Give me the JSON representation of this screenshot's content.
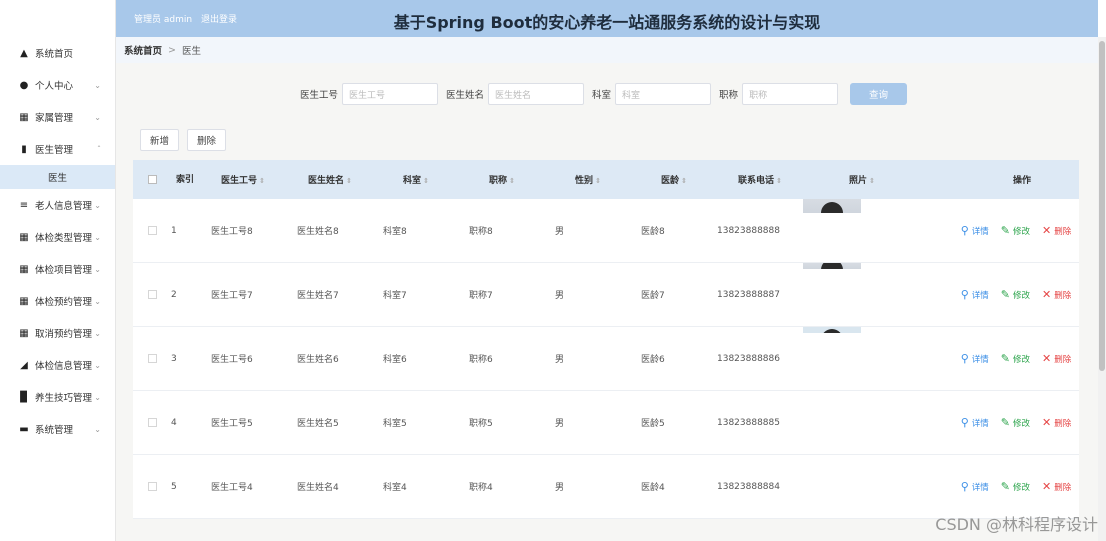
{
  "header": {
    "admin_label": "管理员 admin",
    "logout_label": "退出登录",
    "title": "基于Spring Boot的安心养老一站通服务系统的设计与实现"
  },
  "sidebar": {
    "items": [
      {
        "label": "系统首页",
        "icon": "home-icon"
      },
      {
        "label": "个人中心",
        "icon": "user-icon"
      },
      {
        "label": "家属管理",
        "icon": "grid-icon"
      },
      {
        "label": "医生管理",
        "icon": "clipboard-icon",
        "expanded": true,
        "children": [
          {
            "label": "医生"
          }
        ]
      },
      {
        "label": "老人信息管理",
        "icon": "list-icon"
      },
      {
        "label": "体检类型管理",
        "icon": "grid-icon"
      },
      {
        "label": "体检项目管理",
        "icon": "grid-icon"
      },
      {
        "label": "体检预约管理",
        "icon": "grid-icon"
      },
      {
        "label": "取消预约管理",
        "icon": "grid-icon"
      },
      {
        "label": "体检信息管理",
        "icon": "chart-icon"
      },
      {
        "label": "养生技巧管理",
        "icon": "bar-icon"
      },
      {
        "label": "系统管理",
        "icon": "stack-icon"
      }
    ]
  },
  "breadcrumb": {
    "home": "系统首页",
    "separator": ">",
    "current": "医生"
  },
  "search": {
    "fields": [
      {
        "label": "医生工号",
        "placeholder": "医生工号"
      },
      {
        "label": "医生姓名",
        "placeholder": "医生姓名"
      },
      {
        "label": "科室",
        "placeholder": "科室"
      },
      {
        "label": "职称",
        "placeholder": "职称"
      }
    ],
    "query_label": "查询"
  },
  "actions": {
    "add_label": "新增",
    "delete_label": "删除"
  },
  "table": {
    "headers": [
      "索引",
      "医生工号",
      "医生姓名",
      "科室",
      "职称",
      "性别",
      "医龄",
      "联系电话",
      "照片",
      "操作"
    ],
    "rows": [
      {
        "idx": "1",
        "no": "医生工号8",
        "name": "医生姓名8",
        "dept": "科室8",
        "title": "职称8",
        "sex": "男",
        "age": "医龄8",
        "phone": "13823888888"
      },
      {
        "idx": "2",
        "no": "医生工号7",
        "name": "医生姓名7",
        "dept": "科室7",
        "title": "职称7",
        "sex": "男",
        "age": "医龄7",
        "phone": "13823888887"
      },
      {
        "idx": "3",
        "no": "医生工号6",
        "name": "医生姓名6",
        "dept": "科室6",
        "title": "职称6",
        "sex": "男",
        "age": "医龄6",
        "phone": "13823888886"
      },
      {
        "idx": "4",
        "no": "医生工号5",
        "name": "医生姓名5",
        "dept": "科室5",
        "title": "职称5",
        "sex": "男",
        "age": "医龄5",
        "phone": "13823888885"
      },
      {
        "idx": "5",
        "no": "医生工号4",
        "name": "医生姓名4",
        "dept": "科室4",
        "title": "职称4",
        "sex": "男",
        "age": "医龄4",
        "phone": "13823888884"
      }
    ],
    "ops": {
      "detail": "详情",
      "edit": "修改",
      "delete": "删除"
    }
  },
  "watermark": "CSDN @林科程序设计"
}
